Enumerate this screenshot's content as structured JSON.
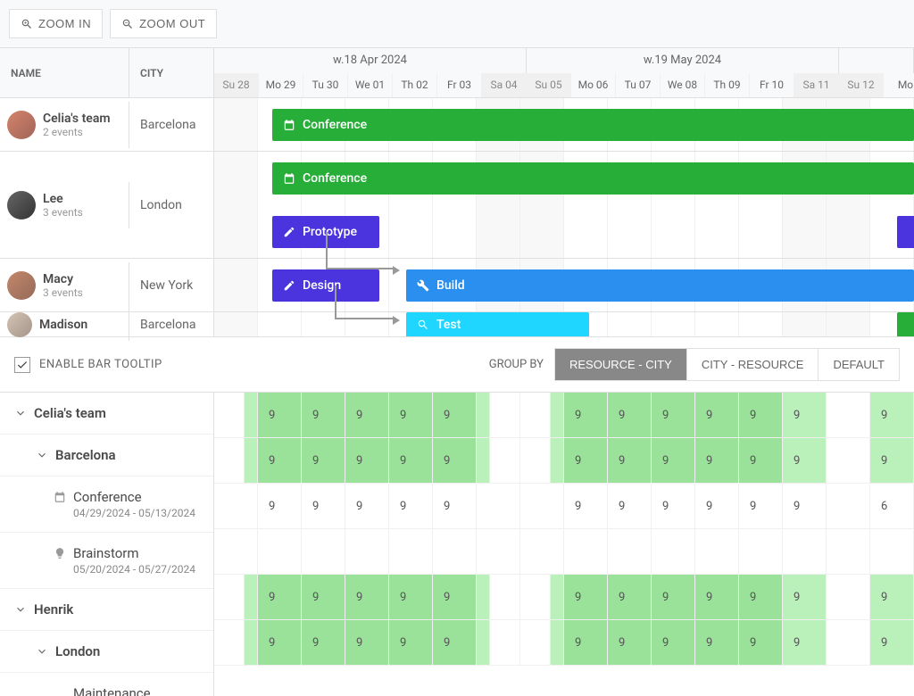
{
  "toolbar": {
    "zoom_in": "ZOOM IN",
    "zoom_out": "ZOOM OUT"
  },
  "headers": {
    "name": "NAME",
    "city": "CITY",
    "weeks": [
      "w.18 Apr 2024",
      "w.19 May 2024"
    ],
    "days": [
      "Su 28",
      "Mo 29",
      "Tu 30",
      "We 01",
      "Th 02",
      "Fr 03",
      "Sa 04",
      "Su 05",
      "Mo 06",
      "Tu 07",
      "We 08",
      "Th 09",
      "Fr 10",
      "Sa 11",
      "Su 12",
      "Mo"
    ]
  },
  "resources": [
    {
      "name": "Celia's team",
      "sub": "2 events",
      "city": "Barcelona"
    },
    {
      "name": "Lee",
      "sub": "3 events",
      "city": "London"
    },
    {
      "name": "Macy",
      "sub": "3 events",
      "city": "New York"
    },
    {
      "name": "Madison",
      "sub": "",
      "city": "Barcelona"
    }
  ],
  "events": {
    "conference1": "Conference",
    "conference2": "Conference",
    "prototype": "Prototype",
    "design": "Design",
    "build": "Build",
    "test": "Test"
  },
  "options": {
    "checkbox_label": "ENABLE BAR TOOLTIP",
    "group_by": "GROUP BY",
    "seg1": "RESOURCE - CITY",
    "seg2": "CITY - RESOURCE",
    "seg3": "DEFAULT"
  },
  "tree": {
    "celia": "Celia's team",
    "barcelona": "Barcelona",
    "conf": "Conference",
    "conf_dates": "04/29/2024 - 05/13/2024",
    "brain": "Brainstorm",
    "brain_dates": "05/20/2024 - 05/27/2024",
    "henrik": "Henrik",
    "london": "London",
    "maint": "Maintenance"
  },
  "nine": "9"
}
